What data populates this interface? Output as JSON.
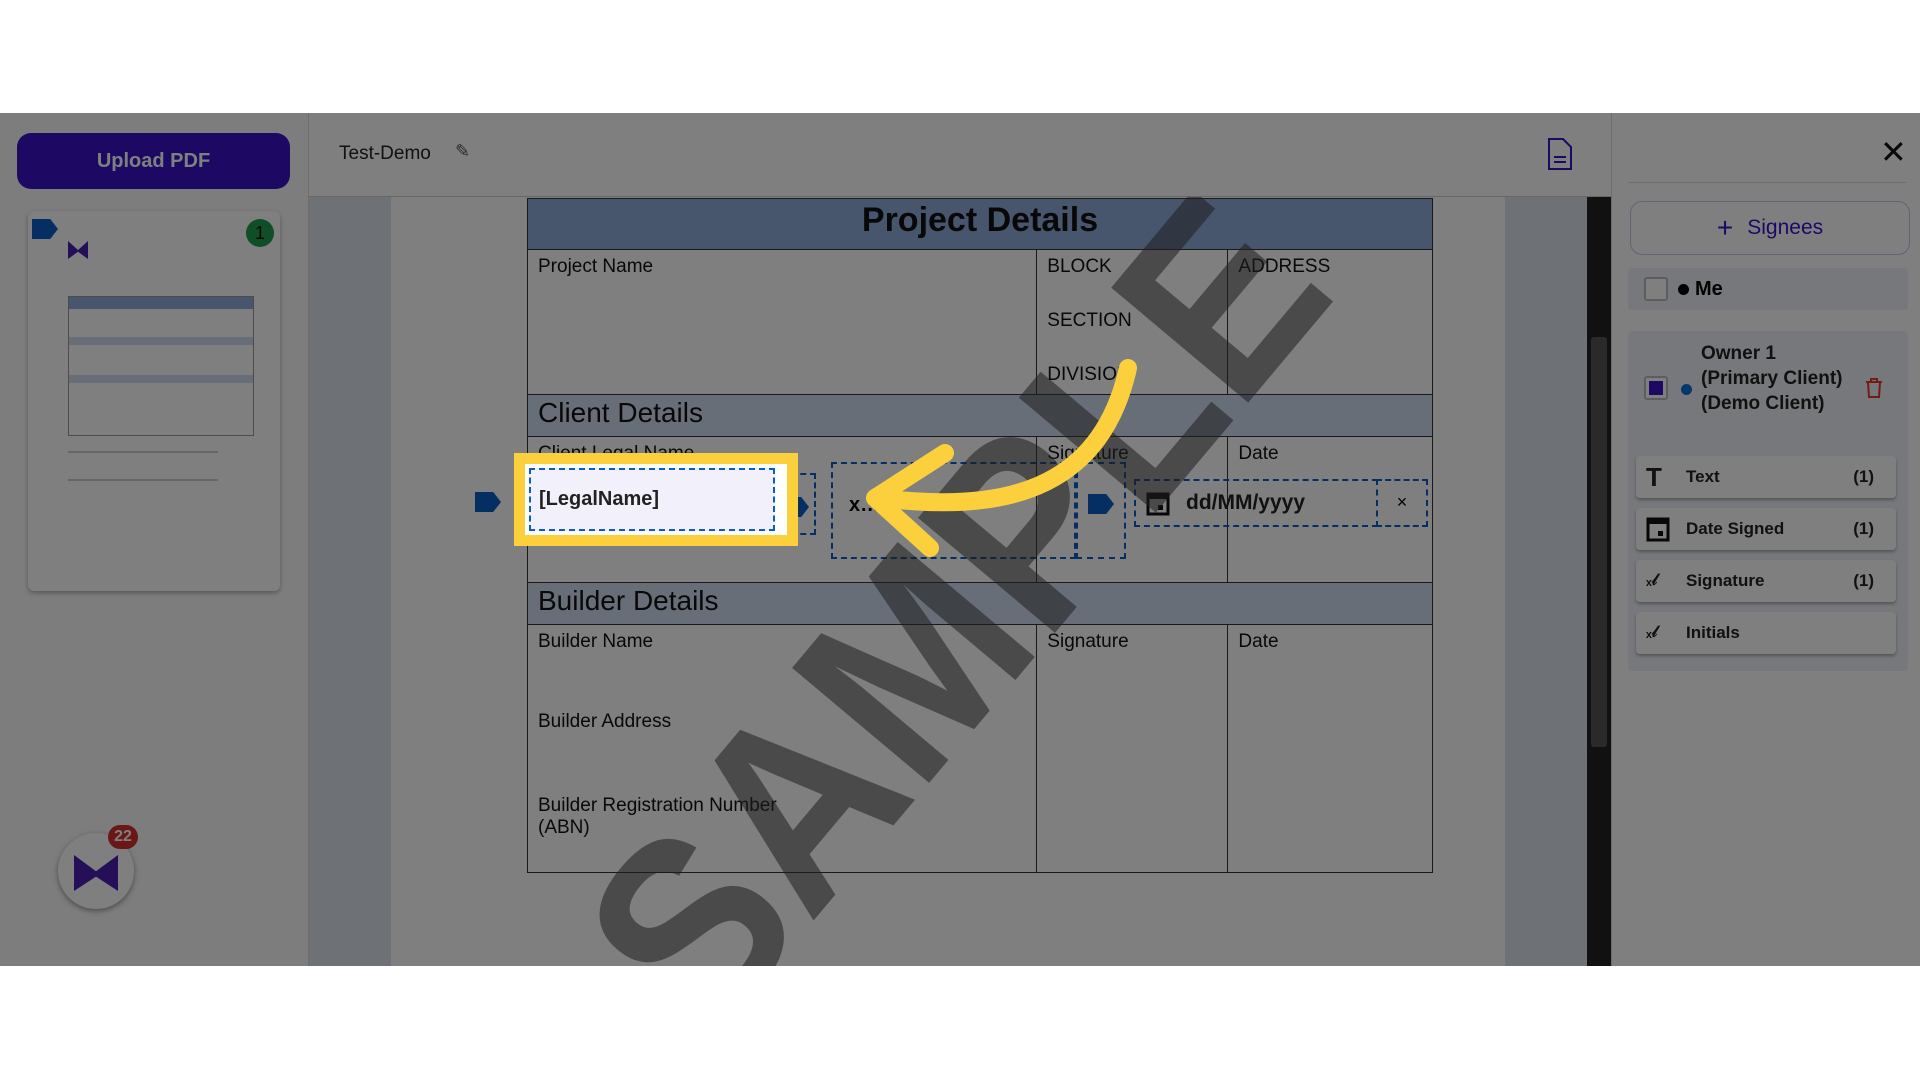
{
  "sidebar": {
    "upload_label": "Upload PDF",
    "page_badge": "1",
    "app_badge": "22"
  },
  "header": {
    "title": "Test-Demo"
  },
  "document": {
    "project_title": "Project Details",
    "project_name": "Project Name",
    "block": "BLOCK",
    "section": "SECTION",
    "division": "DIVISION",
    "address": "ADDRESS",
    "client_title": "Client Details",
    "client_legal_name": "Client Legal Name",
    "signature": "Signature",
    "date": "Date",
    "builder_title": "Builder Details",
    "builder_name": "Builder Name",
    "builder_address": "Builder Address",
    "builder_reg": "Builder Registration Number (ABN)",
    "watermark": "SAMPLE"
  },
  "fields": {
    "legal_name": "[LegalName]",
    "date_placeholder": "dd/MM/yyyy",
    "clear": "×"
  },
  "panel": {
    "add_signees": "Signees",
    "me": "Me",
    "owner": "Owner 1 (Primary Client) (Demo Client)",
    "items": [
      {
        "label": "Text",
        "count": "(1)"
      },
      {
        "label": "Date Signed",
        "count": "(1)"
      },
      {
        "label": "Signature",
        "count": "(1)"
      },
      {
        "label": "Initials",
        "count": ""
      }
    ]
  },
  "colors": {
    "accent": "#3a12c8",
    "field": "#0a5cc7",
    "highlight": "#fcd03c",
    "badge_green": "#1f9d4c",
    "badge_red": "#d32f2f"
  }
}
